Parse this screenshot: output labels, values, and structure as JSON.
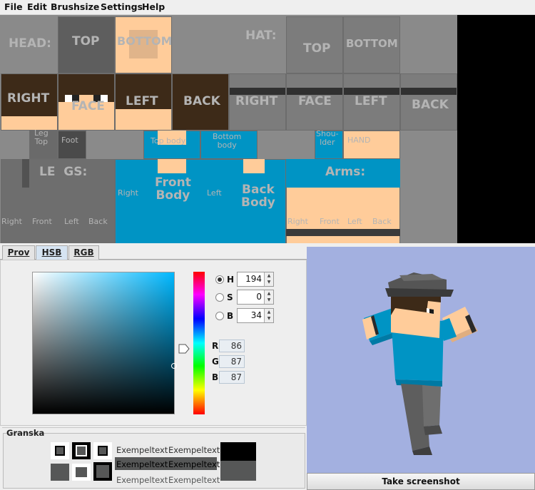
{
  "menu": [
    "File",
    "Edit",
    "Brushsize",
    "Settings",
    "Help"
  ],
  "skin_labels": {
    "head": "HEAD:",
    "top": "TOP",
    "bottom": "BOTTOM",
    "hat": "HAT:",
    "hat_top": "TOP",
    "hat_bottom": "BOTTOM",
    "right": "RIGHT",
    "face": "FACE",
    "left": "LEFT",
    "back": "BACK",
    "hat_right": "RIGHT",
    "hat_face": "FACE",
    "hat_left": "LEFT",
    "hat_back": "BACK",
    "leg_top": "Leg\nTop",
    "foot": "Foot",
    "top_body": "Top body",
    "bottom_body": "Bottom\nbody",
    "shoulder": "Shou-\nlder",
    "hand": "HAND",
    "legs": "LE  GS:",
    "arms": "Arms:",
    "front_body": "Front\nBody",
    "back_body": "Back\nBody",
    "body_right": "Right",
    "body_left": "Left",
    "leg_right": "Right",
    "leg_front": "Front",
    "leg_left": "Left",
    "leg_back": "Back",
    "arm_right": "Right",
    "arm_front": "Front",
    "arm_left": "Left",
    "arm_back": "Back"
  },
  "tabs": [
    "Prov",
    "HSB",
    "RGB"
  ],
  "active_tab": "HSB",
  "hsb": {
    "h_label": "H",
    "h": "194",
    "s_label": "S",
    "s": "0",
    "b_label": "B",
    "b": "34",
    "selected": "H"
  },
  "rgb": {
    "r_label": "R",
    "r": "86",
    "g_label": "G",
    "g": "87",
    "b_label": "B",
    "b": "87"
  },
  "granska": {
    "title": "Granska",
    "rows": [
      [
        "Exempeltext",
        "Exempeltext"
      ],
      [
        "Exempeltext",
        "Exempeltext"
      ],
      [
        "Exempeltext",
        "Exempeltext"
      ]
    ]
  },
  "preview": {
    "button": "Take screenshot"
  },
  "colors": {
    "skin": "#ffcc9a",
    "shirt": "#0094c4",
    "hair": "#3d2a18",
    "hat": "#505050",
    "pants": "#606060"
  }
}
